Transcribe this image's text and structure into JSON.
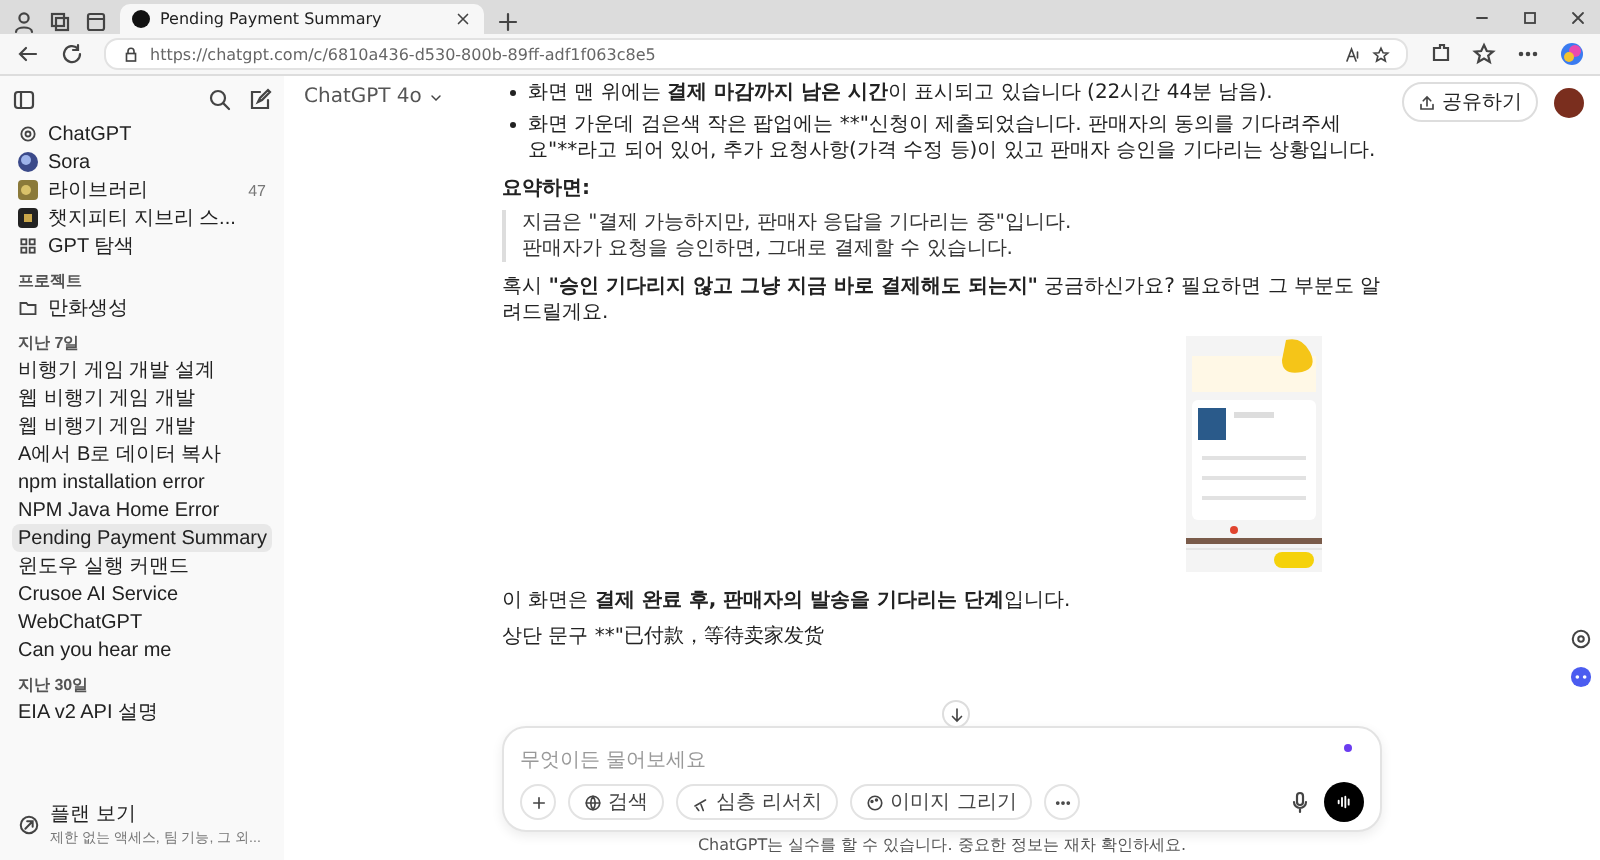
{
  "browser": {
    "tab_title": "Pending Payment Summary",
    "url": "https://chatgpt.com/c/6810a436-d530-800b-89ff-adf1f063c8e5"
  },
  "sidebar": {
    "top_items": [
      {
        "label": "ChatGPT",
        "kind": "gpt"
      },
      {
        "label": "Sora",
        "kind": "sora"
      },
      {
        "label": "라이브러리",
        "kind": "library",
        "count": "47"
      },
      {
        "label": "챗지피티 지브리 스...",
        "kind": "gizmo"
      },
      {
        "label": "GPT 탐색",
        "kind": "explore"
      }
    ],
    "sections": [
      {
        "title": "프로젝트",
        "items": [
          {
            "label": "만화생성",
            "kind": "folder",
            "selected": false
          }
        ]
      },
      {
        "title": "지난 7일",
        "items": [
          {
            "label": "비행기 게임 개발 설계",
            "selected": false
          },
          {
            "label": "웹 비행기 게임 개발",
            "selected": false
          },
          {
            "label": "웹 비행기 게임 개발",
            "selected": false
          },
          {
            "label": "A에서 B로 데이터 복사",
            "selected": false
          },
          {
            "label": "npm installation error",
            "selected": false
          },
          {
            "label": "NPM Java Home Error",
            "selected": false
          },
          {
            "label": "Pending Payment Summary",
            "selected": true
          },
          {
            "label": "윈도우 실행 커맨드",
            "selected": false
          },
          {
            "label": "Crusoe AI Service",
            "selected": false
          },
          {
            "label": "WebChatGPT",
            "selected": false
          },
          {
            "label": "Can you hear me",
            "selected": false
          }
        ]
      },
      {
        "title": "지난 30일",
        "items": [
          {
            "label": "EIA v2 API 설명",
            "selected": false
          }
        ]
      }
    ],
    "plan": {
      "title": "플랜 보기",
      "subtitle": "제한 없는 액세스, 팀 기능, 그 외..."
    }
  },
  "header": {
    "model": "ChatGPT 4o",
    "share": "공유하기"
  },
  "messages": [
    {
      "kind": "bullet",
      "segments": [
        {
          "text": "화면 맨 위에는 "
        },
        {
          "text": "결제 마감까지 남은 시간",
          "bold": true
        },
        {
          "text": "이 표시되고 있습니다 (22시간 44분 남음)."
        }
      ]
    },
    {
      "kind": "bullet",
      "segments": [
        {
          "text": "화면 가운데 검은색 작은 팝업에는 **\"신청이 제출되었습니다. 판매자의 동의를 기다려주세요\"**라고 되어 있어, 추가 요청사항(가격 수정 등)이 있고 판매자 승인을 기다리는 상황입니다."
        }
      ]
    },
    {
      "kind": "heading",
      "segments": [
        {
          "text": "요약하면:"
        }
      ]
    },
    {
      "kind": "quote",
      "lines": [
        "지금은 \"결제 가능하지만, 판매자 응답을 기다리는 중\"입니다.",
        "판매자가 요청을 승인하면, 그대로 결제할 수 있습니다."
      ]
    },
    {
      "kind": "para",
      "segments": [
        {
          "text": "혹시 "
        },
        {
          "text": "\"승인 기다리지 않고 그냥 지금 바로 결제해도 되는지\"",
          "bold": true
        },
        {
          "text": " 궁금하신가요? 필요하면 그 부분도 알려드릴게요."
        }
      ]
    },
    {
      "kind": "picture"
    },
    {
      "kind": "para",
      "segments": [
        {
          "text": "이 화면은 "
        },
        {
          "text": "결제 완료 후, 판매자의 발송을 기다리는 단계",
          "bold": true
        },
        {
          "text": "입니다."
        }
      ]
    },
    {
      "kind": "para",
      "segments": [
        {
          "text": "상단 문구 **\"已付款，等待卖家发货"
        }
      ]
    }
  ],
  "composer": {
    "placeholder": "무엇이든 물어보세요",
    "tools": [
      {
        "label": "검색",
        "kind": "search"
      },
      {
        "label": "심층 리서치",
        "kind": "research"
      },
      {
        "label": "이미지 그리기"
      }
    ]
  },
  "footer": "ChatGPT는 실수를 할 수 있습니다. 중요한 정보는 재차 확인하세요."
}
